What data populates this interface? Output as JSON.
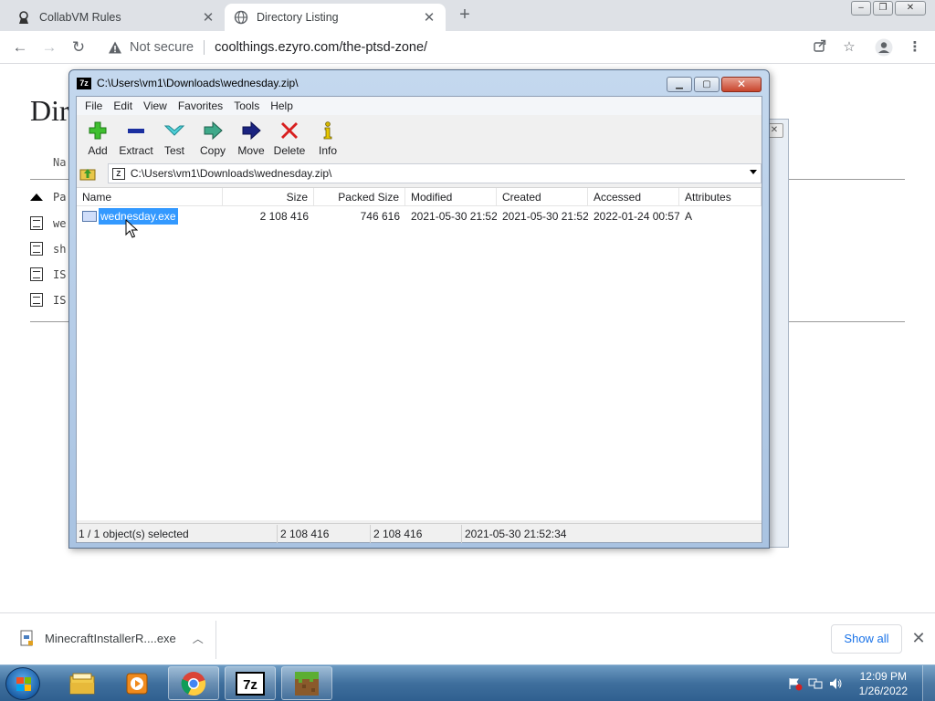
{
  "browser": {
    "tabs": [
      {
        "title": "CollabVM Rules",
        "active": false
      },
      {
        "title": "Directory Listing",
        "active": true
      }
    ],
    "new_tab": "+",
    "security_label": "Not secure",
    "url": "coolthings.ezyro.com/the-ptsd-zone/"
  },
  "page": {
    "heading": "Dir",
    "column_header": "Na",
    "rows": [
      "Pa",
      "we",
      "sh",
      "IS",
      "IS"
    ]
  },
  "sevenzip": {
    "title": "C:\\Users\\vm1\\Downloads\\wednesday.zip\\",
    "logo": "7z",
    "menu": [
      "File",
      "Edit",
      "View",
      "Favorites",
      "Tools",
      "Help"
    ],
    "tools": [
      {
        "label": "Add",
        "icon": "add-icon"
      },
      {
        "label": "Extract",
        "icon": "extract-icon"
      },
      {
        "label": "Test",
        "icon": "test-icon"
      },
      {
        "label": "Copy",
        "icon": "copy-icon"
      },
      {
        "label": "Move",
        "icon": "move-icon"
      },
      {
        "label": "Delete",
        "icon": "delete-icon"
      },
      {
        "label": "Info",
        "icon": "info-icon"
      }
    ],
    "address": "C:\\Users\\vm1\\Downloads\\wednesday.zip\\",
    "columns": [
      "Name",
      "Size",
      "Packed Size",
      "Modified",
      "Created",
      "Accessed",
      "Attributes"
    ],
    "files": [
      {
        "name": "wednesday.exe",
        "size": "2 108 416",
        "packed": "746 616",
        "modified": "2021-05-30 21:52",
        "created": "2021-05-30 21:52",
        "accessed": "2022-01-24 00:57",
        "attributes": "A"
      }
    ],
    "status": {
      "selection": "1 / 1 object(s) selected",
      "size": "2 108 416",
      "packed": "2 108 416",
      "modified": "2021-05-30 21:52:34"
    }
  },
  "downloads": {
    "file": "MinecraftInstallerR....exe",
    "show_all": "Show all"
  },
  "taskbar": {
    "time": "12:09 PM",
    "date": "1/26/2022"
  },
  "colors": {
    "selection": "#3399ff",
    "link": "#1a73e8",
    "taskbar": "#3f6f9d"
  }
}
